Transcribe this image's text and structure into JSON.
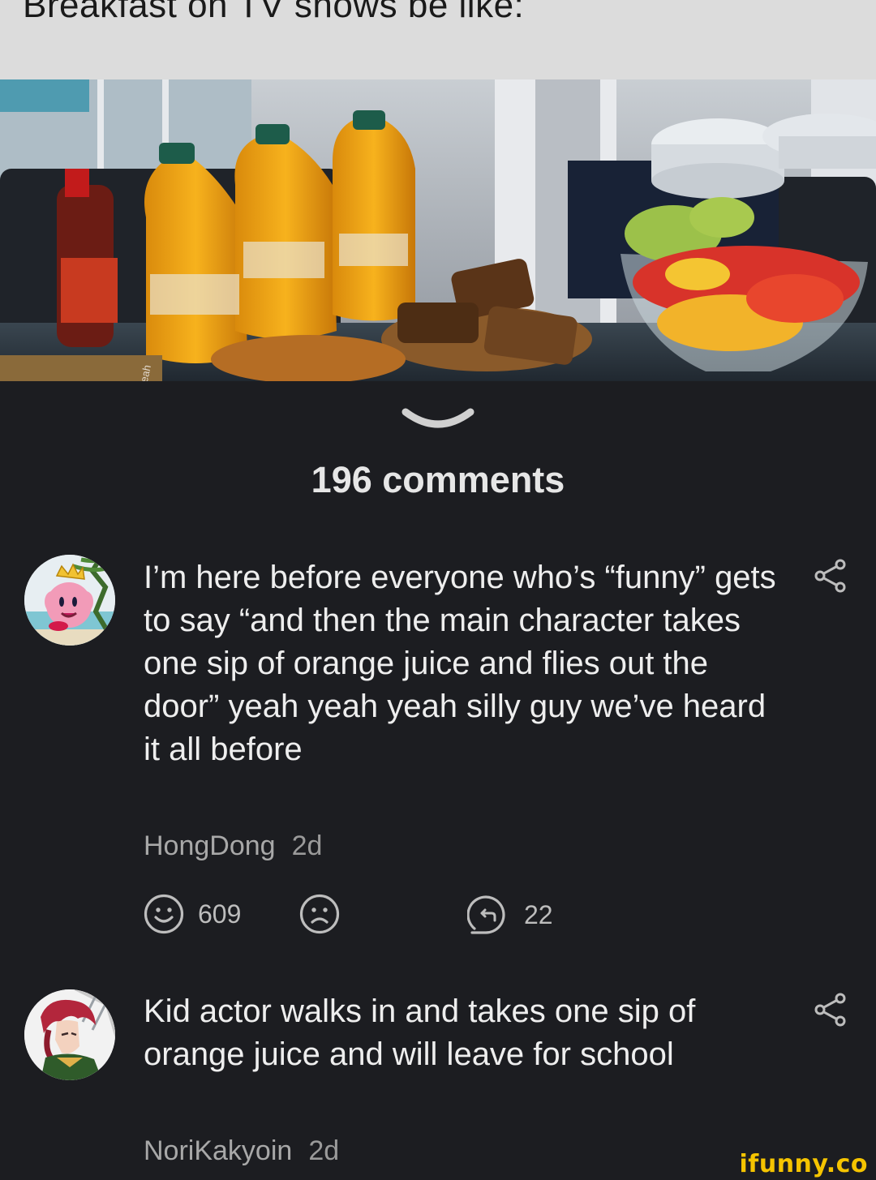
{
  "meme": {
    "caption": "Breakfast on TV shows be like:",
    "photo_watermark": "@foxyeah"
  },
  "comments_header": "196 comments",
  "comments": [
    {
      "text": "I’m here before everyone who’s “funny” gets to say “and then the main character takes one sip of orange juice and flies out the door” yeah yeah yeah silly guy we’ve heard it all before",
      "author": "HongDong",
      "time": "2d",
      "smiles": "609",
      "replies": "22"
    },
    {
      "text": "Kid actor walks in and takes one sip of orange juice and will leave for school",
      "author": "NoriKakyoin",
      "time": "2d"
    }
  ],
  "watermark": "ifunny.co",
  "icons": {
    "collapse": "chevron-down-icon",
    "share": "share-icon",
    "smile": "smile-icon",
    "unsmile": "unsmile-icon",
    "reply": "reply-icon"
  },
  "colors": {
    "background": "#1c1d21",
    "text": "#eeeeee",
    "muted": "#a8a8a8",
    "brand": "#f5c400"
  }
}
